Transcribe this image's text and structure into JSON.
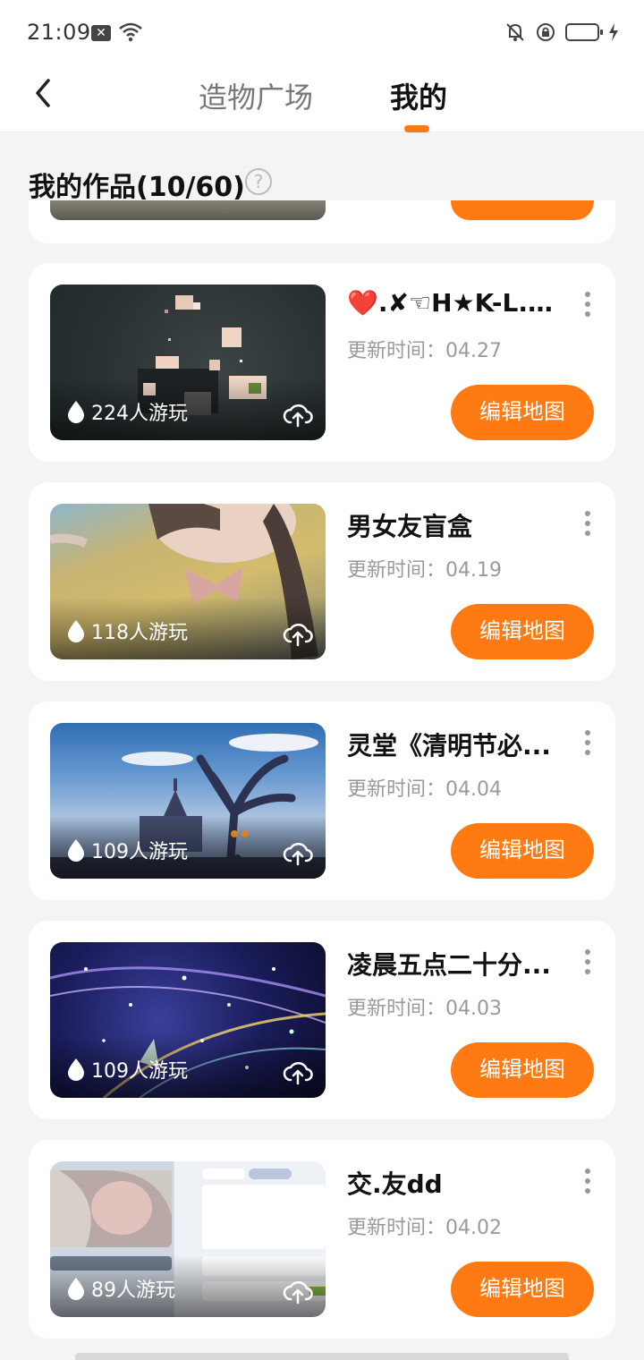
{
  "status_bar": {
    "time": "21:09"
  },
  "nav": {
    "tabs": [
      {
        "label": "造物广场"
      },
      {
        "label": "我的"
      }
    ]
  },
  "section": {
    "title": "我的作品(10/60)",
    "help_label": "?"
  },
  "works": [
    {
      "title": "❤️.✘☜H★K-L....",
      "updated": "更新时间：04.27",
      "plays": "224人游玩",
      "edit_label": "编辑地图"
    },
    {
      "title": "男女友盲盒",
      "updated": "更新时间：04.19",
      "plays": "118人游玩",
      "edit_label": "编辑地图"
    },
    {
      "title": "灵堂《清明节必...",
      "updated": "更新时间：04.04",
      "plays": "109人游玩",
      "edit_label": "编辑地图"
    },
    {
      "title": "凌晨五点二十分...",
      "updated": "更新时间：04.03",
      "plays": "109人游玩",
      "edit_label": "编辑地图"
    },
    {
      "title": "交.友dd",
      "updated": "更新时间：04.02",
      "plays": "89人游玩",
      "edit_label": "编辑地图"
    }
  ],
  "icons": {
    "back": "chevron-left-icon",
    "more": "more-vertical-icon",
    "plays": "flame-drop-icon",
    "upload": "cloud-upload-icon",
    "help": "question-circle-icon"
  },
  "colors": {
    "accent": "#ff7a12",
    "background": "#f4f4f5",
    "card": "#ffffff"
  }
}
